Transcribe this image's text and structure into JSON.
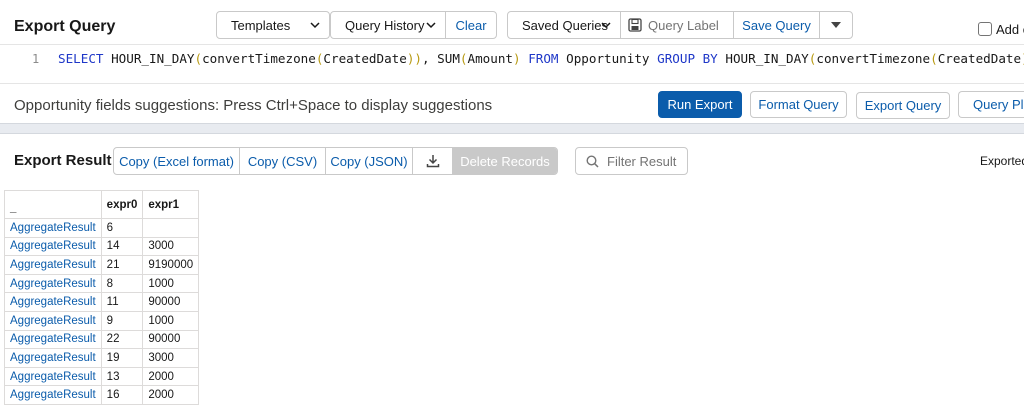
{
  "header": {
    "title": "Export Query",
    "templates_label": "Templates",
    "query_history_label": "Query History",
    "clear_label": "Clear",
    "saved_queries_label": "Saved Queries",
    "query_label_placeholder": "Query Label",
    "save_query_label": "Save Query",
    "add_checkbox_label": "Add c"
  },
  "editor": {
    "line_number": "1",
    "tokens": [
      {
        "t": "SELECT ",
        "k": "kw"
      },
      {
        "t": "HOUR_IN_DAY",
        "k": "fn"
      },
      {
        "t": "(",
        "k": "p"
      },
      {
        "t": "convertTimezone",
        "k": "fn"
      },
      {
        "t": "(",
        "k": "p"
      },
      {
        "t": "CreatedDate",
        "k": "fn"
      },
      {
        "t": ")",
        "k": "p"
      },
      {
        "t": ")",
        "k": "p"
      },
      {
        "t": ", ",
        "k": "p"
      },
      {
        "t": "SUM",
        "k": "fn"
      },
      {
        "t": "(",
        "k": "p"
      },
      {
        "t": "Amount",
        "k": "fn"
      },
      {
        "t": ") ",
        "k": "p"
      },
      {
        "t": "FROM ",
        "k": "kw"
      },
      {
        "t": "Opportunity ",
        "k": "fn"
      },
      {
        "t": "GROUP BY ",
        "k": "kw"
      },
      {
        "t": "HOUR_IN_DAY",
        "k": "fn"
      },
      {
        "t": "(",
        "k": "p"
      },
      {
        "t": "convertTimezone",
        "k": "fn"
      },
      {
        "t": "(",
        "k": "p"
      },
      {
        "t": "CreatedDate",
        "k": "fn"
      },
      {
        "t": ")",
        "k": "p"
      },
      {
        "t": ")",
        "k": "p"
      }
    ]
  },
  "hint": "Opportunity fields suggestions: Press Ctrl+Space to display suggestions",
  "actions": {
    "run_export": "Run Export",
    "format_query": "Format Query",
    "export_query": "Export Query",
    "query_plan": "Query Plan"
  },
  "result": {
    "title": "Export Result",
    "copy_excel": "Copy (Excel format)",
    "copy_csv": "Copy (CSV)",
    "copy_json": "Copy (JSON)",
    "delete_records": "Delete Records",
    "filter_placeholder": "Filter Result",
    "exported_label": "Exported",
    "columns": [
      "_",
      "expr0",
      "expr1"
    ],
    "rows": [
      [
        "AggregateResult",
        "6",
        ""
      ],
      [
        "AggregateResult",
        "14",
        "3000"
      ],
      [
        "AggregateResult",
        "21",
        "9190000"
      ],
      [
        "AggregateResult",
        "8",
        "1000"
      ],
      [
        "AggregateResult",
        "11",
        "90000"
      ],
      [
        "AggregateResult",
        "9",
        "1000"
      ],
      [
        "AggregateResult",
        "22",
        "90000"
      ],
      [
        "AggregateResult",
        "19",
        "3000"
      ],
      [
        "AggregateResult",
        "13",
        "2000"
      ],
      [
        "AggregateResult",
        "16",
        "2000"
      ]
    ]
  },
  "colors": {
    "accent": "#0b5cab",
    "keyword": "#1e37c8",
    "paren": "#b89a12",
    "disabled": "#c9c9c9"
  }
}
